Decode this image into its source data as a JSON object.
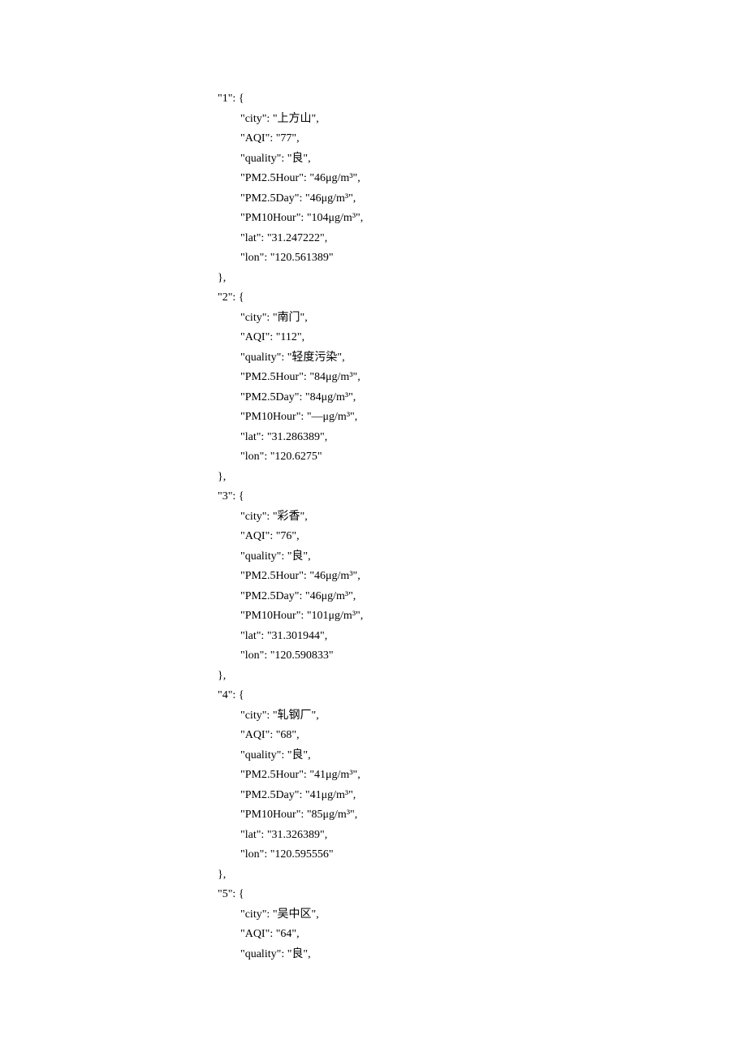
{
  "entries": [
    {
      "key": "1",
      "city": "上方山",
      "AQI": "77",
      "quality": "良",
      "PM25Hour": "46μg/m³",
      "PM25Day": "46μg/m³",
      "PM10Hour": "104μg/m³",
      "lat": "31.247222",
      "lon": "120.561389"
    },
    {
      "key": "2",
      "city": "南门",
      "AQI": "112",
      "quality": "轻度污染",
      "PM25Hour": "84μg/m³",
      "PM25Day": "84μg/m³",
      "PM10Hour": "—μg/m³",
      "lat": "31.286389",
      "lon": "120.6275"
    },
    {
      "key": "3",
      "city": "彩香",
      "AQI": "76",
      "quality": "良",
      "PM25Hour": "46μg/m³",
      "PM25Day": "46μg/m³",
      "PM10Hour": "101μg/m³",
      "lat": "31.301944",
      "lon": "120.590833"
    },
    {
      "key": "4",
      "city": "轧钢厂",
      "AQI": "68",
      "quality": "良",
      "PM25Hour": "41μg/m³",
      "PM25Day": "41μg/m³",
      "PM10Hour": "85μg/m³",
      "lat": "31.326389",
      "lon": "120.595556"
    },
    {
      "key": "5",
      "city": "吴中区",
      "AQI": "64",
      "quality": "良",
      "partial": true
    }
  ],
  "labels": {
    "city": "city",
    "AQI": "AQI",
    "quality": "quality",
    "PM25Hour": "PM2.5Hour",
    "PM25Day": "PM2.5Day",
    "PM10Hour": "PM10Hour",
    "lat": "lat",
    "lon": "lon"
  }
}
